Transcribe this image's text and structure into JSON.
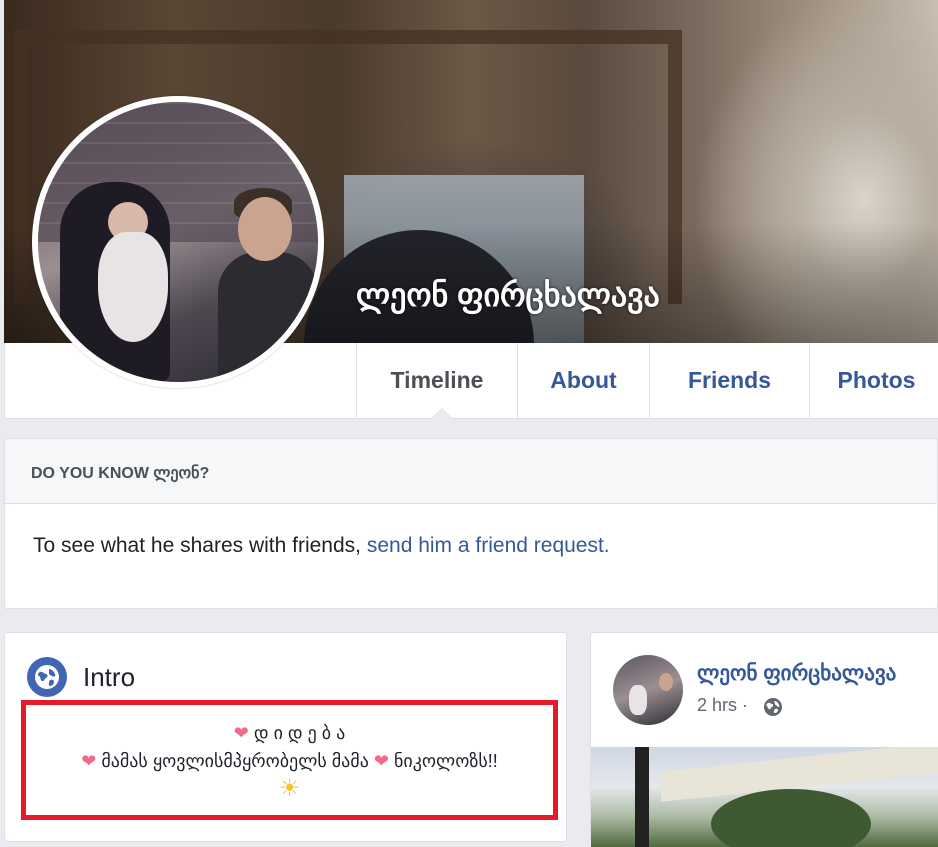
{
  "profile": {
    "name": "ლეონ ფირცხალავა"
  },
  "nav": {
    "tabs": [
      {
        "label": "Timeline",
        "active": true
      },
      {
        "label": "About",
        "active": false
      },
      {
        "label": "Friends",
        "active": false
      },
      {
        "label": "Photos",
        "active": false
      }
    ]
  },
  "know_card": {
    "title": "DO YOU KNOW ლეონ?",
    "text": "To see what he shares with friends, ",
    "link": "send him a friend request."
  },
  "intro": {
    "title": "Intro",
    "bio_line1": "დ ი დ ე ბ ა",
    "bio_line2_a": "მამას ყოვლისმპყრობელს მამა",
    "bio_line2_b": "ნიკოლოზს!!",
    "heart_icon": "❤",
    "sun_icon": "☀"
  },
  "post": {
    "author": "ლეონ ფირცხალავა",
    "time": "2 hrs ·"
  },
  "colors": {
    "link": "#365899",
    "highlight_border": "#e21b2a",
    "page_bg": "#e9ebee"
  }
}
